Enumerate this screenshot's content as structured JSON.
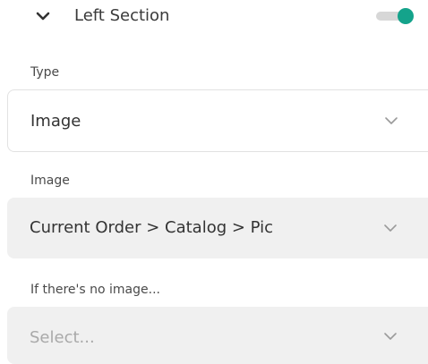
{
  "section": {
    "title": "Left Section",
    "enabled": true,
    "accent_color": "#14a38b",
    "collapse_icon": "chevron-down-icon"
  },
  "fields": {
    "type": {
      "label": "Type",
      "value": "Image",
      "icon": "chevron-down-icon"
    },
    "image": {
      "label": "Image",
      "value": "Current Order > Catalog > Pic",
      "icon": "chevron-down-icon"
    },
    "fallback": {
      "label": "If there's no image...",
      "placeholder": "Select...",
      "icon": "chevron-down-icon"
    }
  }
}
